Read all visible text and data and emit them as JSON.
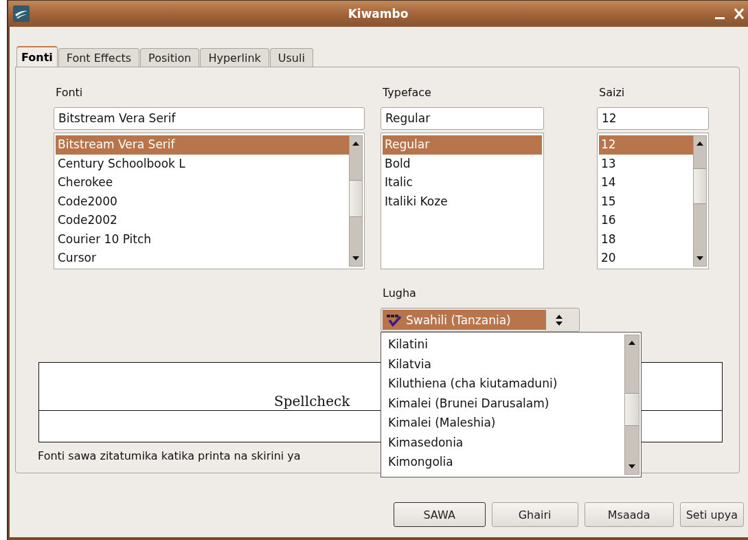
{
  "window": {
    "title": "Kiwambo"
  },
  "tabs": [
    {
      "label": "Fonti",
      "selected": true
    },
    {
      "label": "Font Effects",
      "selected": false
    },
    {
      "label": "Position",
      "selected": false
    },
    {
      "label": "Hyperlink",
      "selected": false
    },
    {
      "label": "Usuli",
      "selected": false
    }
  ],
  "fields": [
    {
      "label": "Fonti",
      "value": "Bitstream Vera Serif",
      "scrollbar": true,
      "items": [
        {
          "label": "Bitstream Vera Serif",
          "selected": true
        },
        {
          "label": "Century Schoolbook L",
          "selected": false
        },
        {
          "label": "Cherokee",
          "selected": false
        },
        {
          "label": "Code2000",
          "selected": false
        },
        {
          "label": "Code2002",
          "selected": false
        },
        {
          "label": "Courier 10 Pitch",
          "selected": false
        },
        {
          "label": "Cursor",
          "selected": false
        }
      ]
    },
    {
      "label": "Typeface",
      "value": "Regular",
      "scrollbar": false,
      "items": [
        {
          "label": "Regular",
          "selected": true
        },
        {
          "label": "Bold",
          "selected": false
        },
        {
          "label": "Italic",
          "selected": false
        },
        {
          "label": "Italiki Koze",
          "selected": false
        }
      ]
    },
    {
      "label": "Saizi",
      "value": "12",
      "scrollbar": true,
      "items": [
        {
          "label": "12",
          "selected": true
        },
        {
          "label": "13",
          "selected": false
        },
        {
          "label": "14",
          "selected": false
        },
        {
          "label": "15",
          "selected": false
        },
        {
          "label": "16",
          "selected": false
        },
        {
          "label": "18",
          "selected": false
        },
        {
          "label": "20",
          "selected": false
        }
      ]
    }
  ],
  "language": {
    "label": "Lugha",
    "value": "Swahili (Tanzania)",
    "options": [
      {
        "label": "Kilatini",
        "selected": false
      },
      {
        "label": "Kilatvia",
        "selected": false
      },
      {
        "label": "Kiluthiena (cha kiutamaduni)",
        "selected": false
      },
      {
        "label": "Kimalei (Brunei Darusalam)",
        "selected": false
      },
      {
        "label": "Kimalei (Maleshia)",
        "selected": false
      },
      {
        "label": "Kimasedonia",
        "selected": false
      },
      {
        "label": "Kimongolia",
        "selected": false
      }
    ]
  },
  "preview": {
    "text": "Spellcheck"
  },
  "note": "Fonti sawa zitatumika katika printa na skirini ya",
  "buttons": [
    {
      "label": "SAWA",
      "default": true
    },
    {
      "label": "Ghairi",
      "default": false
    },
    {
      "label": "Msaada",
      "default": false
    },
    {
      "label": "Seti upya",
      "default": false
    }
  ]
}
